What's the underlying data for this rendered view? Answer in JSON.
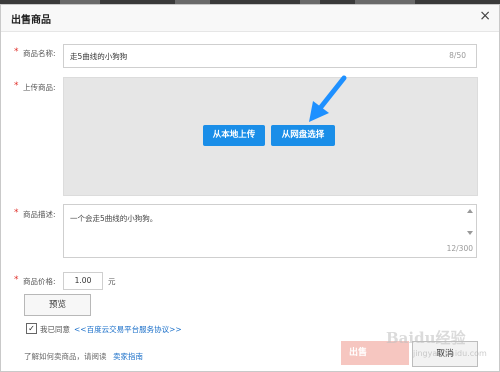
{
  "dialog": {
    "title": "出售商品",
    "close_symbol": "×"
  },
  "form": {
    "required_mark": "*",
    "name_label": "商品名称:",
    "name_value": "走5曲线的小狗狗",
    "name_count": "8/50",
    "upload_label": "上传商品:",
    "upload_local_button": "从本地上传",
    "upload_netdisk_button": "从网盘选择",
    "desc_label": "商品描述:",
    "desc_value": "一个会走5曲线的小狗狗。",
    "desc_count": "12/300",
    "price_label": "商品价格:",
    "price_value": "1.00",
    "price_unit": "元"
  },
  "actions": {
    "preview_button": "预览",
    "agree_check": "✓",
    "agree_prefix": "我已同意",
    "agree_link": "<<百度云交易平台服务协议>>",
    "guide_text": "了解如何卖商品，请阅读",
    "guide_link": "卖家指南",
    "sell_button": "出售",
    "cancel_button": "取消"
  },
  "watermark": {
    "brand": "Baidu经验",
    "sub": "jingyan.baidu.com"
  },
  "colors": {
    "primary_blue": "#1a8ee8",
    "required_red": "#e0302a",
    "link_blue": "#1a6fc9",
    "arrow_blue": "#1e90ff"
  },
  "icons": {
    "close": "close-icon",
    "pointer": "pointer-arrow-icon",
    "check": "check-icon"
  }
}
